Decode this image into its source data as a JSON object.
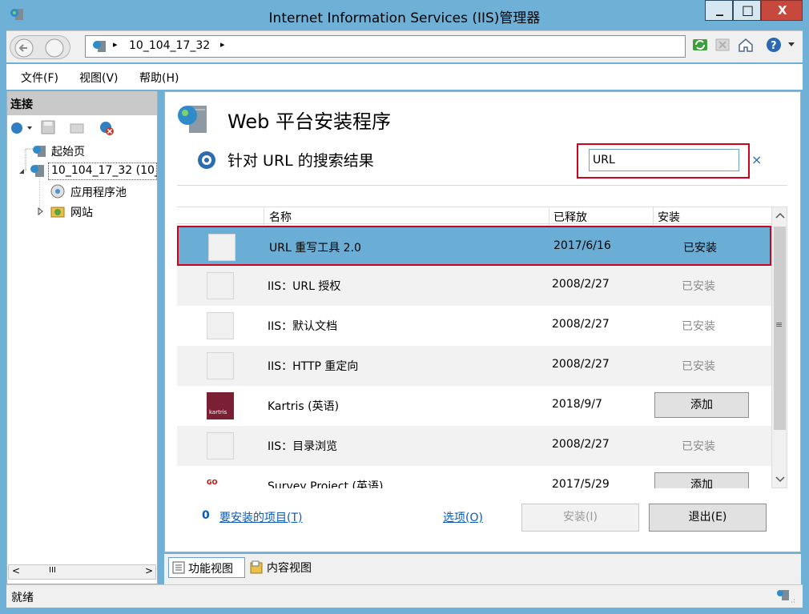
{
  "window": {
    "title": "Internet Information Services (IIS)管理器",
    "min_glyph": "_",
    "max_glyph": "□",
    "close_glyph": "X"
  },
  "address": {
    "crumb_sep": "▸",
    "server": "10_104_17_32",
    "tail": "▸"
  },
  "menu": {
    "file": "文件(F)",
    "view": "视图(V)",
    "help": "帮助(H)"
  },
  "connections": {
    "header": "连接",
    "tree": {
      "start_page": "起始页",
      "server": "10_104_17_32 (10_",
      "app_pools": "应用程序池",
      "sites": "网站"
    },
    "hscroll_thumb": "III"
  },
  "wpi": {
    "title": "Web 平台安装程序",
    "search_result_label": "针对 URL 的搜索结果",
    "search_value": "URL",
    "clear_glyph": "×",
    "columns": {
      "name": "名称",
      "released": "已释放",
      "install": "安装"
    },
    "rows": [
      {
        "name": "URL 重写工具 2.0",
        "date": "2017/6/16",
        "status": "已安装"
      },
      {
        "name": "IIS：URL 授权",
        "date": "2008/2/27",
        "status": "已安装"
      },
      {
        "name": "IIS：默认文档",
        "date": "2008/2/27",
        "status": "已安装"
      },
      {
        "name": "IIS：HTTP 重定向",
        "date": "2008/2/27",
        "status": "已安装"
      },
      {
        "name": "Kartris (英语)",
        "date": "2018/9/7",
        "add": "添加",
        "logo_text": "kartris"
      },
      {
        "name": "IIS：目录浏览",
        "date": "2008/2/27",
        "status": "已安装"
      },
      {
        "name": "Survey Project (英语)",
        "date": "2017/5/29",
        "add": "添加",
        "logo_text": "GO"
      }
    ],
    "vscroll_mid": "≡",
    "footer": {
      "count": "0",
      "to_install": "要安装的项目(T)",
      "options": "选项(O)",
      "install": "安装(I)",
      "exit": "退出(E)"
    }
  },
  "tabs": {
    "features": "功能视图",
    "content": "内容视图"
  },
  "status": {
    "text": "就绪"
  },
  "colors": {
    "accent": "#6fb0d6",
    "selected_row": "#6aaed6",
    "highlight_border": "#d0021b",
    "link": "#0b5ab3"
  }
}
